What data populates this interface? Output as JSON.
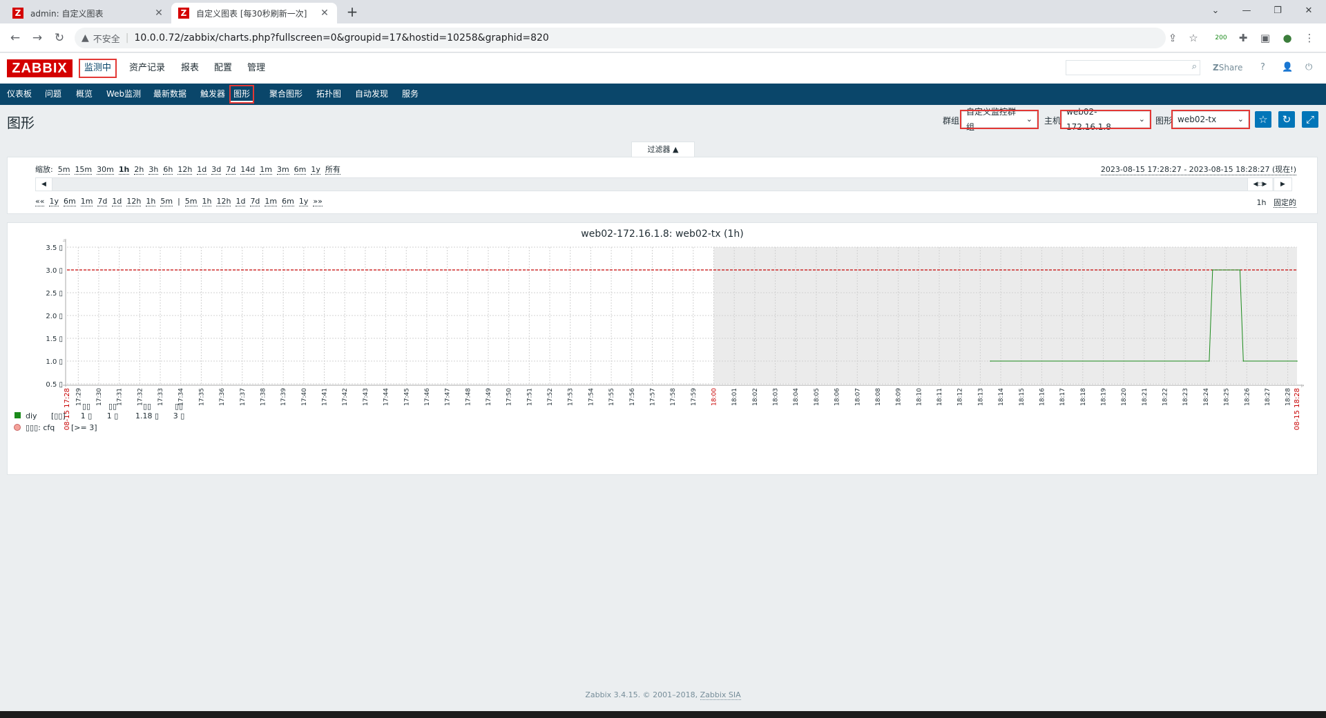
{
  "browser": {
    "tabs": [
      {
        "icon": "Z",
        "title": "admin: 自定义图表",
        "active": false
      },
      {
        "icon": "Z",
        "title": "自定义图表 [每30秒刷新一次]",
        "active": true
      }
    ],
    "address": {
      "security": "不安全",
      "url": "10.0.0.72/zabbix/charts.php?fullscreen=0&groupid=17&hostid=10258&graphid=820"
    },
    "extension_badge": "200"
  },
  "header": {
    "logo": "ZABBIX",
    "main_menu": [
      "监测中",
      "资产记录",
      "报表",
      "配置",
      "管理"
    ],
    "share": "Share",
    "help": "?"
  },
  "sub_menu": [
    "仪表板",
    "问题",
    "概览",
    "Web监测",
    "最新数据",
    "触发器",
    "图形",
    "聚合图形",
    "拓扑图",
    "自动发现",
    "服务"
  ],
  "page": {
    "title": "图形",
    "controls": {
      "group_label": "群组",
      "group_value": "自定义监控群组",
      "host_label": "主机",
      "host_value": "web02-172.16.1.8",
      "graph_label": "图形",
      "graph_value": "web02-tx"
    }
  },
  "filter": {
    "tab_label": "过滤器 ▲",
    "zoom_label": "缩放:",
    "zoom_options": [
      "5m",
      "15m",
      "30m",
      "1h",
      "2h",
      "3h",
      "6h",
      "12h",
      "1d",
      "3d",
      "7d",
      "14d",
      "1m",
      "3m",
      "6m",
      "1y",
      "所有"
    ],
    "zoom_selected": "1h",
    "period": "2023-08-15 17:28:27 - 2023-08-15 18:28:27 (现在!)",
    "nav_back": [
      "««",
      "1y",
      "6m",
      "1m",
      "7d",
      "1d",
      "12h",
      "1h",
      "5m",
      "|"
    ],
    "nav_fwd": [
      "5m",
      "1h",
      "12h",
      "1d",
      "7d",
      "1m",
      "6m",
      "1y",
      "»»"
    ],
    "fixed_period": "1h",
    "fixed_label": "固定的"
  },
  "chart_data": {
    "type": "line",
    "title": "web02-172.16.1.8: web02-tx (1h)",
    "x_ticks": [
      "17:29",
      "17:30",
      "17:31",
      "17:32",
      "17:33",
      "17:34",
      "17:35",
      "17:36",
      "17:37",
      "17:38",
      "17:39",
      "17:40",
      "17:41",
      "17:42",
      "17:43",
      "17:44",
      "17:45",
      "17:46",
      "17:47",
      "17:48",
      "17:49",
      "17:50",
      "17:51",
      "17:52",
      "17:53",
      "17:54",
      "17:55",
      "17:56",
      "17:57",
      "17:58",
      "17:59",
      "18:00",
      "18:01",
      "18:02",
      "18:03",
      "18:04",
      "18:05",
      "18:06",
      "18:07",
      "18:08",
      "18:09",
      "18:10",
      "18:11",
      "18:12",
      "18:13",
      "18:14",
      "18:15",
      "18:16",
      "18:17",
      "18:18",
      "18:19",
      "18:20",
      "18:21",
      "18:22",
      "18:23",
      "18:24",
      "18:25",
      "18:26",
      "18:27",
      "18:28"
    ],
    "x_start_label": "08-15 17:28",
    "x_end_label": "08-15 18:28",
    "x_highlight": "18:00",
    "y_ticks": [
      "3.5 ▯",
      "3.0 ▯",
      "2.5 ▯",
      "2.0 ▯",
      "1.5 ▯",
      "1.0 ▯",
      "0.5 ▯"
    ],
    "ylim": [
      0.5,
      3.5
    ],
    "series": [
      {
        "name": "diy",
        "color": "#1a8a1a",
        "points": [
          [
            "18:13:30",
            1.0
          ],
          [
            "18:24:10",
            1.0
          ],
          [
            "18:24:20",
            3.0
          ],
          [
            "18:25:40",
            3.0
          ],
          [
            "18:25:50",
            1.0
          ],
          [
            "18:28:27",
            1.0
          ]
        ]
      }
    ],
    "trigger": {
      "value": 3.0,
      "color": "#c80000",
      "label": "▯▯▯: cfq",
      "condition": "[>= 3]"
    },
    "legend": {
      "headers": [
        "▯▯",
        "▯▯",
        "▯▯",
        "▯▯"
      ],
      "row": {
        "name": "diy",
        "type": "[▯▯]",
        "values": [
          "1 ▯",
          "1 ▯",
          "1.18 ▯",
          "3 ▯"
        ]
      }
    }
  },
  "footer": {
    "text": "Zabbix 3.4.15. © 2001–2018, ",
    "link": "Zabbix SIA"
  }
}
